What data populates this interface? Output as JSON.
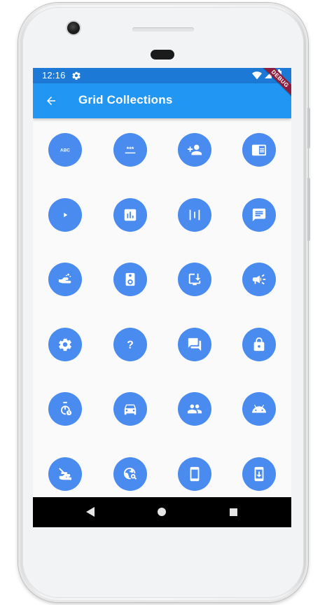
{
  "status_bar": {
    "time": "12:16",
    "icons": [
      "gear-icon",
      "wifi-icon",
      "signal-icon",
      "battery-icon"
    ]
  },
  "app_bar": {
    "back_icon": "arrow-back-icon",
    "title": "Grid Collections",
    "debug_banner": "DEBUG"
  },
  "colors": {
    "status_bar": "#1c7ad6",
    "app_bar": "#2196f3",
    "icon_circle": "#4a8bf0",
    "background": "#fafafa",
    "nav_bar": "#000000"
  },
  "grid": {
    "columns": 4,
    "items": [
      {
        "icon": "abc-icon"
      },
      {
        "icon": "password-icon"
      },
      {
        "icon": "person-add-icon"
      },
      {
        "icon": "chrome-reader-mode-icon"
      },
      {
        "icon": "play-arrow-icon"
      },
      {
        "icon": "assessment-icon"
      },
      {
        "icon": "vertical-bars-icon"
      },
      {
        "icon": "chat-icon"
      },
      {
        "icon": "wash-hands-icon"
      },
      {
        "icon": "speaker-icon"
      },
      {
        "icon": "install-desktop-icon"
      },
      {
        "icon": "campaign-icon"
      },
      {
        "icon": "settings-icon"
      },
      {
        "icon": "help-icon"
      },
      {
        "icon": "forum-icon"
      },
      {
        "icon": "lock-icon"
      },
      {
        "icon": "timer-icon"
      },
      {
        "icon": "car-icon"
      },
      {
        "icon": "group-icon"
      },
      {
        "icon": "android-icon"
      },
      {
        "icon": "no-hands-icon"
      },
      {
        "icon": "travel-explore-icon"
      },
      {
        "icon": "smartphone-icon"
      },
      {
        "icon": "system-update-icon"
      }
    ]
  },
  "nav_bar": {
    "icons": [
      "nav-back-icon",
      "nav-home-icon",
      "nav-recent-icon"
    ]
  }
}
